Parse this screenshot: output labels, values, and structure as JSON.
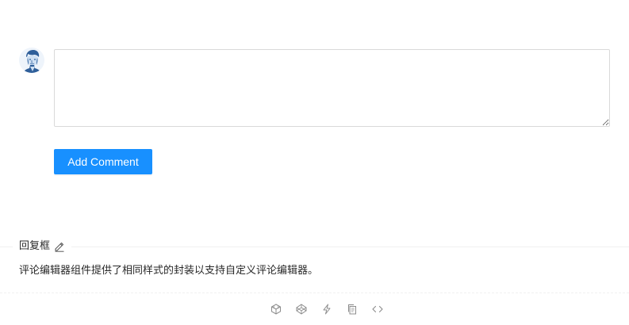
{
  "editor": {
    "value": "",
    "placeholder": ""
  },
  "buttons": {
    "add_comment": "Add Comment"
  },
  "meta": {
    "title": "回复框",
    "description": "评论编辑器组件提供了相同样式的封装以支持自定义评论编辑器。"
  },
  "icons": {
    "avatar": "user-avatar",
    "edit": "edit-icon",
    "actions": [
      "codesandbox-icon",
      "codepen-icon",
      "thunderbolt-icon",
      "copy-icon",
      "code-icon"
    ]
  },
  "colors": {
    "primary": "#1890ff",
    "border": "#d9d9d9",
    "divider": "#f0f0f0",
    "icon": "#8c8c8c"
  }
}
